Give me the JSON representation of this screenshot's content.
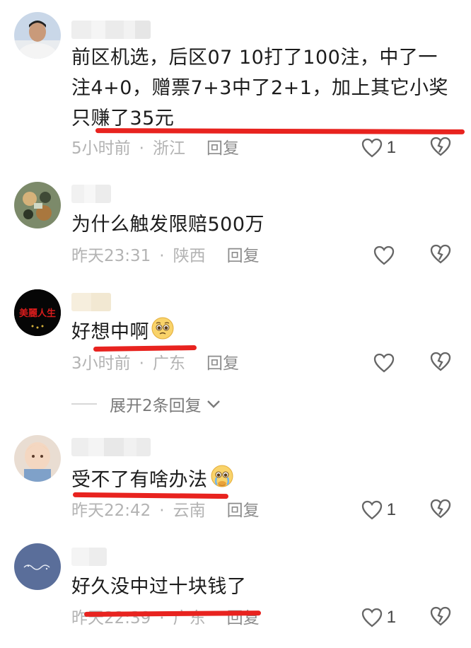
{
  "comments": [
    {
      "text_lines": [
        "前区机选，后区07 10打了100注，中了一",
        "注4+0，赠票7+3中了2+1，加上其它小奖",
        "只赚了35元"
      ],
      "time": "5小时前",
      "location": "浙江",
      "reply": "回复",
      "likes": "1"
    },
    {
      "text_lines": [
        "为什么触发限赔500万"
      ],
      "time": "昨天23:31",
      "location": "陕西",
      "reply": "回复",
      "likes": ""
    },
    {
      "text_lines": [
        "好想中啊"
      ],
      "emoji": "pleading-face-icon",
      "avatar_text": "美麗人生",
      "time": "3小时前",
      "location": "广东",
      "reply": "回复",
      "likes": ""
    },
    {
      "text_lines": [
        "受不了有啥办法"
      ],
      "emoji": "crying-pleading-face-icon",
      "time": "昨天22:42",
      "location": "云南",
      "reply": "回复",
      "likes": "1"
    },
    {
      "text_lines": [
        "好久没中过十块钱了"
      ],
      "time": "昨天22:39",
      "location": "广东",
      "reply": "回复",
      "likes": "1"
    }
  ],
  "expand_replies": "展开2条回复",
  "colors": {
    "underline": "#e8231f",
    "meta": "#b3b3b3",
    "text": "#1c1c1c"
  }
}
